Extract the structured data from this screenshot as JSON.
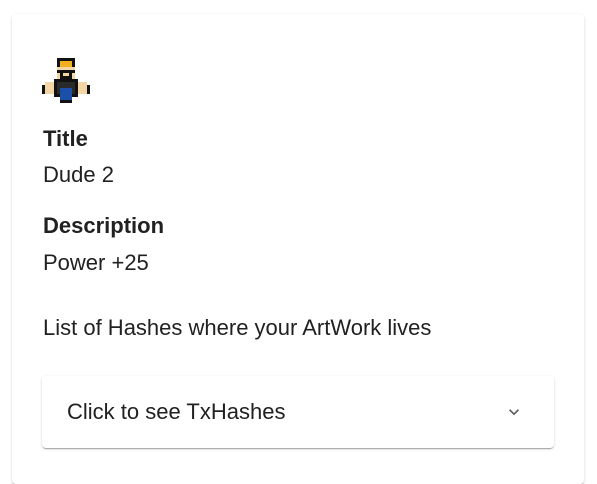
{
  "item": {
    "avatar_icon": "pixel-dude-icon",
    "title_label": "Title",
    "title_value": "Dude 2",
    "description_label": "Description",
    "description_value": "Power +25",
    "hashes_text": "List of Hashes where your ArtWork lives"
  },
  "accordion": {
    "label": "Click to see TxHashes",
    "icon": "chevron-down-icon",
    "expanded": false
  },
  "colors": {
    "text": "#212121",
    "hair": "#f2b01e",
    "shirt": "#1c4fa8",
    "glasses": "#111111",
    "skin": "#f3d6a4"
  }
}
